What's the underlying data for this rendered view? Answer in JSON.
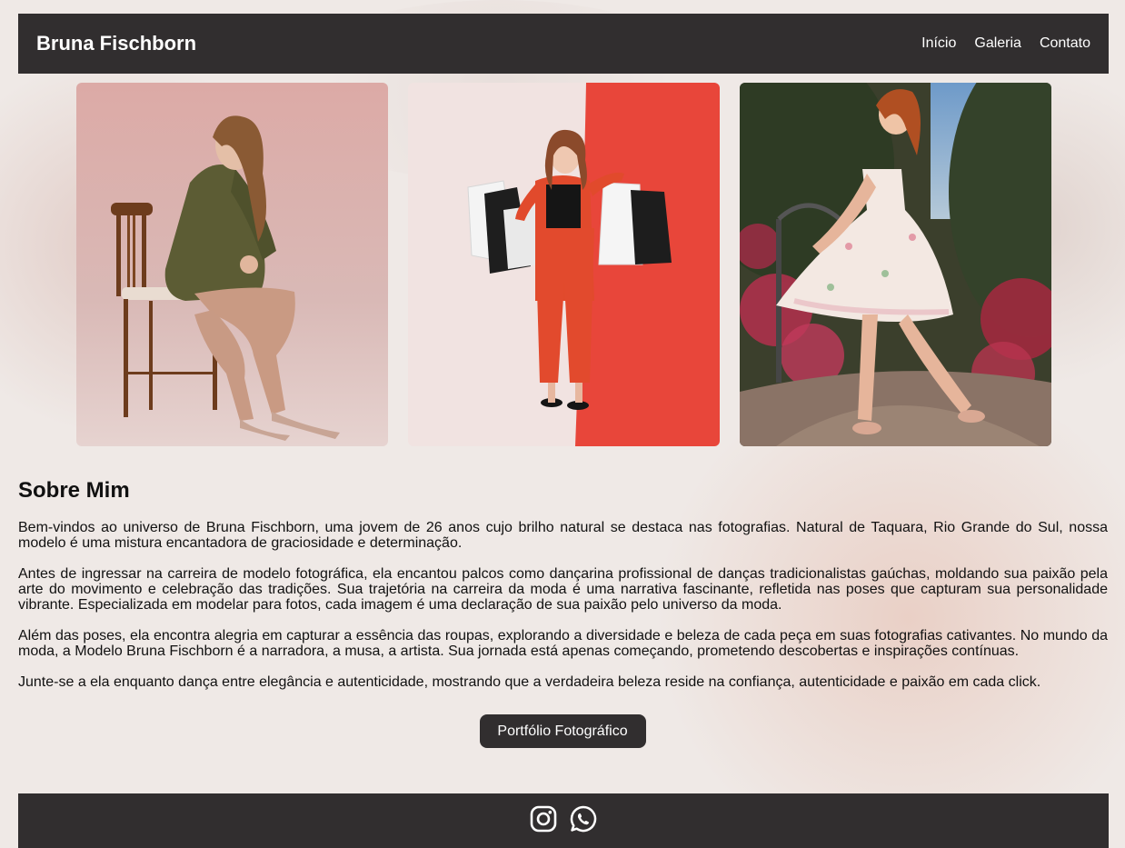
{
  "header": {
    "brand": "Bruna Fischborn",
    "nav": [
      "Início",
      "Galeria",
      "Contato"
    ]
  },
  "gallery": [
    {
      "icon": "photo-model-seated-chair"
    },
    {
      "icon": "photo-model-shopping-bags"
    },
    {
      "icon": "photo-model-floral-dress"
    }
  ],
  "about": {
    "title": "Sobre Mim",
    "paragraphs": [
      "Bem-vindos ao universo de Bruna Fischborn, uma jovem de 26 anos cujo brilho natural se destaca nas fotografias. Natural de Taquara, Rio Grande do Sul, nossa modelo é uma mistura encantadora de graciosidade e determinação.",
      "Antes de ingressar na carreira de modelo fotográfica, ela encantou palcos como dançarina profissional de danças tradicionalistas gaúchas, moldando sua paixão pela arte do movimento e celebração das tradições. Sua trajetória na carreira da moda é uma narrativa fascinante, refletida nas poses que capturam sua personalidade vibrante. Especializada em modelar para fotos, cada imagem é uma declaração de sua paixão pelo universo da moda.",
      "Além das poses, ela encontra alegria em capturar a essência das roupas, explorando a diversidade e beleza de cada peça em suas fotografias cativantes. No mundo da moda, a Modelo Bruna Fischborn é a narradora, a musa, a artista. Sua jornada está apenas começando, prometendo descobertas e inspirações contínuas.",
      "Junte-se a ela enquanto dança entre elegância e autenticidade, mostrando que a verdadeira beleza reside na confiança, autenticidade e paixão em cada click."
    ],
    "cta": "Portfólio Fotográfico"
  },
  "footer": {
    "icons": [
      "instagram-icon",
      "whatsapp-icon"
    ]
  },
  "colors": {
    "bar": "#312e2f",
    "accent_red": "#e8463a"
  }
}
